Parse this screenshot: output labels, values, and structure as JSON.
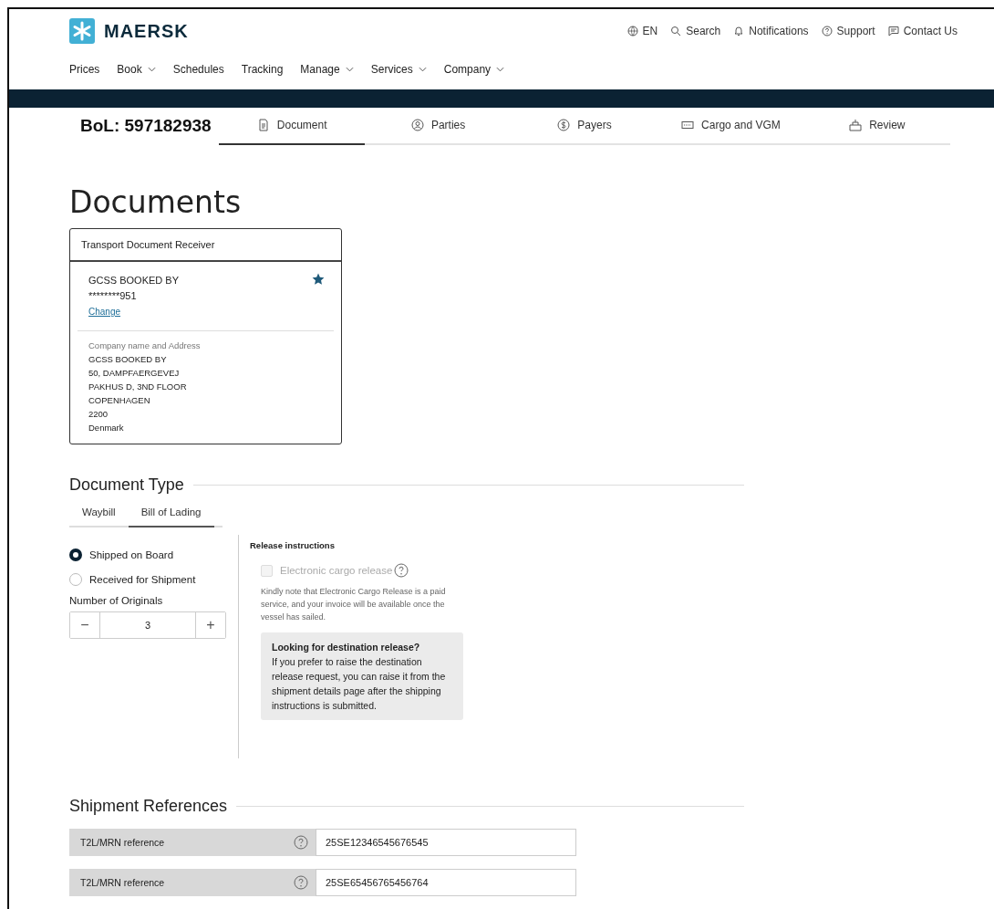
{
  "header": {
    "brand": "MAERSK",
    "utility": [
      {
        "kind": "globe",
        "label": "EN"
      },
      {
        "kind": "search",
        "label": "Search"
      },
      {
        "kind": "bell",
        "label": "Notifications"
      },
      {
        "kind": "help",
        "label": "Support"
      },
      {
        "kind": "chat",
        "label": "Contact Us"
      }
    ],
    "nav": [
      {
        "label": "Prices",
        "dropdown": false
      },
      {
        "label": "Book",
        "dropdown": true
      },
      {
        "label": "Schedules",
        "dropdown": false
      },
      {
        "label": "Tracking",
        "dropdown": false
      },
      {
        "label": "Manage",
        "dropdown": true
      },
      {
        "label": "Services",
        "dropdown": true
      },
      {
        "label": "Company",
        "dropdown": true
      }
    ]
  },
  "steps": {
    "bol": "BoL: 597182938",
    "items": [
      {
        "kind": "document",
        "label": "Document",
        "selected": true
      },
      {
        "kind": "person",
        "label": "Parties",
        "selected": false
      },
      {
        "kind": "dollar",
        "label": "Payers",
        "selected": false
      },
      {
        "kind": "card",
        "label": "Cargo and VGM",
        "selected": false
      },
      {
        "kind": "box",
        "label": "Review",
        "selected": false
      }
    ]
  },
  "title": "Documents",
  "receiver": {
    "heading": "Transport Document Receiver",
    "name": "GCSS BOOKED BY",
    "account": "********951",
    "change": "Change",
    "address_label": "Company name and Address",
    "address_lines": [
      "GCSS BOOKED BY",
      "50, DAMPFAERGEVEJ",
      "PAKHUS D, 3ND FLOOR",
      "COPENHAGEN",
      "2200",
      "Denmark"
    ]
  },
  "document_type": {
    "heading": "Document Type",
    "tabs": [
      {
        "label": "Waybill",
        "selected": false
      },
      {
        "label": "Bill of Lading",
        "selected": true
      }
    ],
    "options": [
      {
        "label": "Shipped on Board",
        "selected": true
      },
      {
        "label": "Received for Shipment",
        "selected": false
      }
    ],
    "originals_label": "Number of Originals",
    "originals_minus": "−",
    "originals_value": "3",
    "originals_plus": "+",
    "release_heading": "Release instructions",
    "ecr": {
      "label": "Electronic cargo release",
      "checked": false,
      "disabled": true
    },
    "ecr_note": "Kindly note that Electronic Cargo Release is a paid service, and your invoice will be available once the vessel has sailed.",
    "info_title": "Looking for destination release?",
    "info_text": "If you prefer to raise the destination release request, you can raise it from the shipment details page after the shipping instructions is submitted."
  },
  "references": {
    "heading": "Shipment References",
    "rows": [
      {
        "label": "T2L/MRN reference",
        "value": "25SE12346545676545"
      },
      {
        "label": "T2L/MRN reference",
        "value": "25SE65456765456764"
      }
    ]
  }
}
